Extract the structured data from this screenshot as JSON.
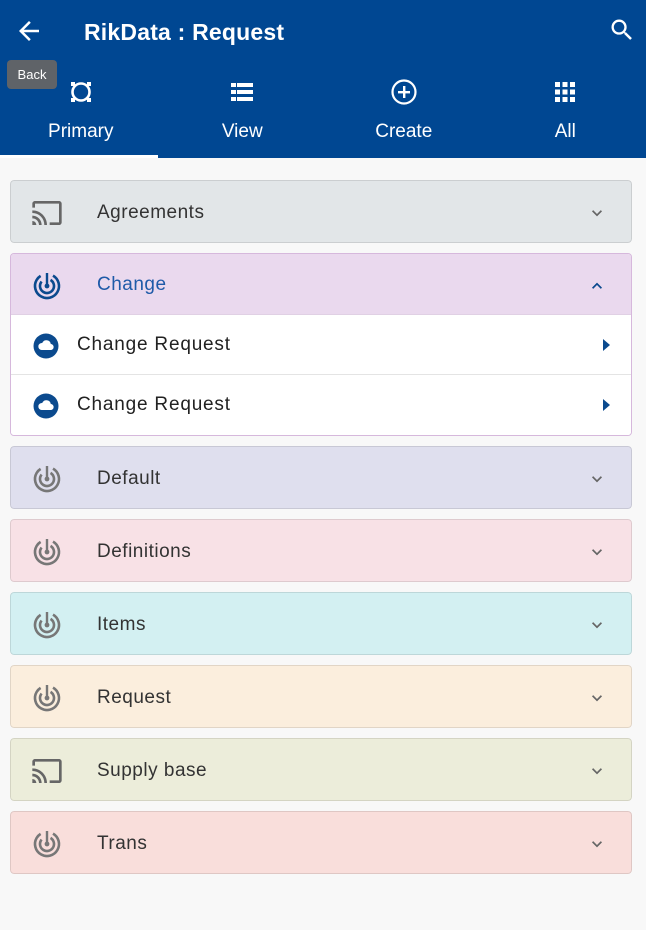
{
  "header": {
    "title": "RikData : Request",
    "back_tooltip": "Back",
    "bg_color": "#004792"
  },
  "tabs": [
    {
      "label": "Primary",
      "icon": "primary-ring-icon",
      "active": true
    },
    {
      "label": "View",
      "icon": "list-view-icon",
      "active": false
    },
    {
      "label": "Create",
      "icon": "add-circle-icon",
      "active": false
    },
    {
      "label": "All",
      "icon": "apps-grid-icon",
      "active": false
    }
  ],
  "groups": [
    {
      "label": "Agreements",
      "icon": "cast-icon",
      "bg": "#e2e6e8"
    },
    {
      "label": "Change",
      "icon": "radar-icon",
      "bg": "#ead9ee",
      "expanded": true,
      "items": [
        {
          "label": "Change Request",
          "icon": "cloud-icon"
        },
        {
          "label": "Change Request",
          "icon": "cloud-icon"
        }
      ]
    },
    {
      "label": "Default",
      "icon": "radar-icon",
      "bg": "#dfdfee"
    },
    {
      "label": "Definitions",
      "icon": "radar-icon",
      "bg": "#f8e1e6"
    },
    {
      "label": "Items",
      "icon": "radar-icon",
      "bg": "#d3f0f2"
    },
    {
      "label": "Request",
      "icon": "radar-icon",
      "bg": "#fbeedd"
    },
    {
      "label": "Supply base",
      "icon": "cast-icon",
      "bg": "#ecedda"
    },
    {
      "label": "Trans",
      "icon": "radar-icon",
      "bg": "#f9dedb"
    }
  ]
}
